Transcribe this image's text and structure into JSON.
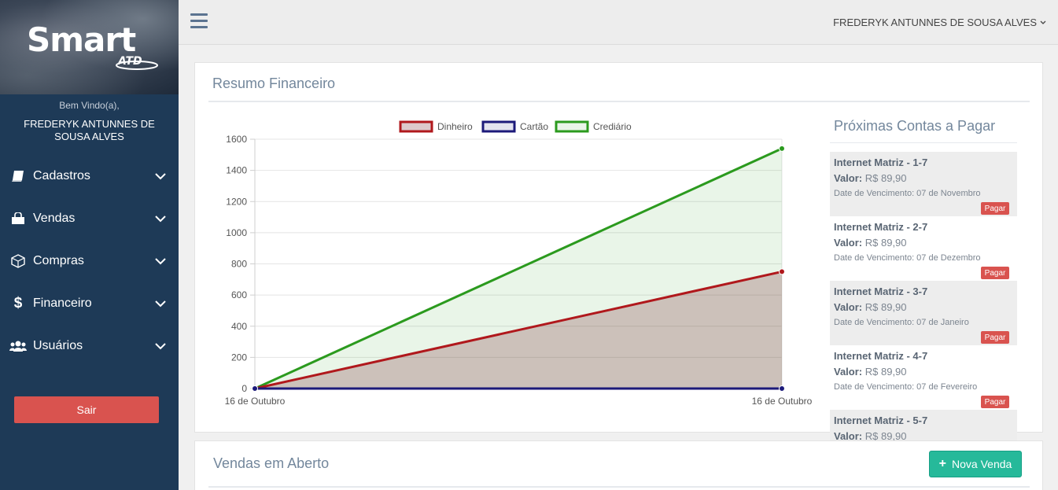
{
  "brand": {
    "logo_text": "Smart",
    "logo_sub": "ATD"
  },
  "sidebar": {
    "welcome": "Bem Vindo(a),",
    "username": "FREDERYK ANTUNNES DE SOUSA ALVES",
    "items": [
      {
        "label": "Cadastros",
        "icon": "book-icon"
      },
      {
        "label": "Vendas",
        "icon": "shopping-bag-icon"
      },
      {
        "label": "Compras",
        "icon": "cube-icon"
      },
      {
        "label": "Financeiro",
        "icon": "dollar-icon"
      },
      {
        "label": "Usuários",
        "icon": "users-icon"
      }
    ],
    "logout_label": "Sair"
  },
  "topbar": {
    "user": "FREDERYK ANTUNNES DE SOUSA ALVES"
  },
  "summary": {
    "title": "Resumo Financeiro",
    "bills_title": "Próximas Contas a Pagar",
    "bills": [
      {
        "name": "Internet Matriz - 1-7",
        "value_label": "Valor:",
        "value": "R$ 89,90",
        "due": "Date de Vencimento: 07 de Novembro",
        "pay": "Pagar"
      },
      {
        "name": "Internet Matriz - 2-7",
        "value_label": "Valor:",
        "value": "R$ 89,90",
        "due": "Date de Vencimento: 07 de Dezembro",
        "pay": "Pagar"
      },
      {
        "name": "Internet Matriz - 3-7",
        "value_label": "Valor:",
        "value": "R$ 89,90",
        "due": "Date de Vencimento: 07 de Janeiro",
        "pay": "Pagar"
      },
      {
        "name": "Internet Matriz - 4-7",
        "value_label": "Valor:",
        "value": "R$ 89,90",
        "due": "Date de Vencimento: 07 de Fevereiro",
        "pay": "Pagar"
      },
      {
        "name": "Internet Matriz - 5-7",
        "value_label": "Valor:",
        "value": "R$ 89,90",
        "due": "",
        "pay": ""
      }
    ]
  },
  "sales": {
    "title": "Vendas em Aberto",
    "new_sale": "Nova Venda"
  },
  "colors": {
    "sidebar": "#1e3a57",
    "danger": "#d9534f",
    "success": "#26b99a",
    "dinheiro": "#b0181c",
    "cartao": "#1c1a7a",
    "crediario": "#2b9a1e"
  },
  "chart_data": {
    "type": "area",
    "x": [
      "16 de Outubro",
      "16 de Outubro"
    ],
    "series": [
      {
        "name": "Dinheiro",
        "values": [
          0,
          750
        ],
        "color": "#b0181c",
        "fill": "rgba(120,40,48,0.25)"
      },
      {
        "name": "Cartão",
        "values": [
          0,
          0
        ],
        "color": "#1c1a7a",
        "fill": "rgba(28,26,122,0.12)"
      },
      {
        "name": "Crediário",
        "values": [
          0,
          1540
        ],
        "color": "#2b9a1e",
        "fill": "rgba(43,154,30,0.10)"
      }
    ],
    "ylim": [
      0,
      1600
    ],
    "yticks": [
      0,
      200,
      400,
      600,
      800,
      1000,
      1200,
      1400,
      1600
    ],
    "legend": "top",
    "grid": true
  }
}
